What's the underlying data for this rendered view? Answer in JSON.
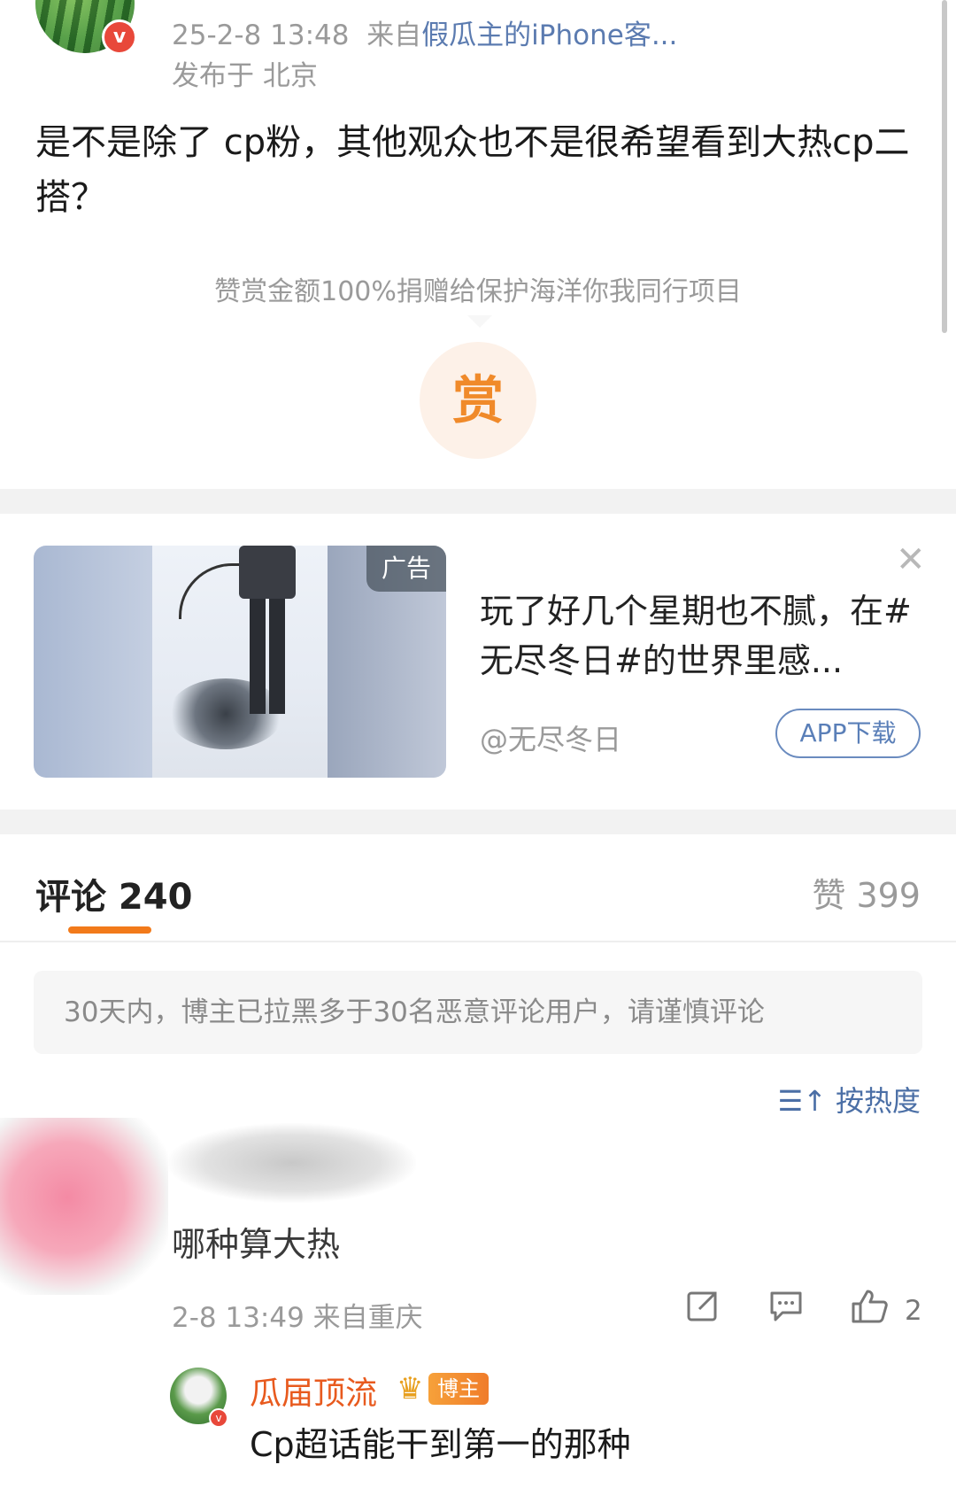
{
  "post": {
    "time": "25-2-8 13:48",
    "source_prefix": "来自",
    "source_name": "假瓜主的iPhone客...",
    "location": "发布于 北京",
    "text": "是不是除了 cp粉，其他观众也不是很希望看到大热cp二搭？",
    "verified_badge": "v"
  },
  "reward": {
    "note": "赞赏金额100%捐赠给保护海洋你我同行项目",
    "button_label": "赏"
  },
  "ad": {
    "badge": "广告",
    "title": "玩了好几个星期也不腻，在#无尽冬日#的世界里感...",
    "handle": "@无尽冬日",
    "app_button": "APP下载",
    "close_icon": "close-icon"
  },
  "comments_header": {
    "tab_label": "评论 240",
    "likes_label": "赞 399"
  },
  "notice": "30天内，博主已拉黑多于30名恶意评论用户，请谨慎评论",
  "sort": {
    "icon": "sort-icon",
    "label": "按热度"
  },
  "comment": {
    "text": "哪种算大热",
    "meta": "2-8 13:49  来自重庆",
    "like_count": "2"
  },
  "reply": {
    "author": "瓜届顶流",
    "badge": "博主",
    "text": "Cp超话能干到第一的那种"
  },
  "colors": {
    "accent_orange": "#f27a1a",
    "link_blue": "#5b7bb0",
    "author_orange": "#e85a1e"
  }
}
